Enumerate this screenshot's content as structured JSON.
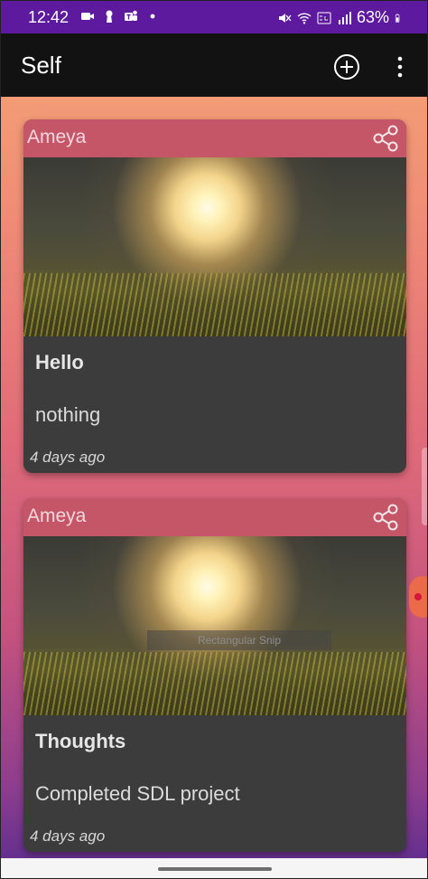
{
  "status_bar": {
    "time": "12:42",
    "battery": "63%",
    "icons": [
      "video-icon",
      "keyhole-icon",
      "teams-icon",
      "dot-icon",
      "mute-icon",
      "wifi-icon",
      "volte-icon",
      "signal-icon",
      "battery-icon"
    ]
  },
  "app_bar": {
    "title": "Self",
    "actions": [
      "add-circle-icon",
      "more-vert-icon"
    ]
  },
  "cards": [
    {
      "author": "Ameya",
      "title": "Hello",
      "body": "nothing",
      "time": "4 days ago"
    },
    {
      "author": "Ameya",
      "title": "Thoughts",
      "body": "Completed SDL project",
      "time": "4 days ago"
    }
  ],
  "overlay": {
    "snip_label": "Rectangular Snip"
  },
  "colors": {
    "status_bar_bg": "#5e1a9f",
    "app_bar_bg": "#121212",
    "card_header": "#dc5a6e",
    "card_bg": "#3c3c3c"
  }
}
